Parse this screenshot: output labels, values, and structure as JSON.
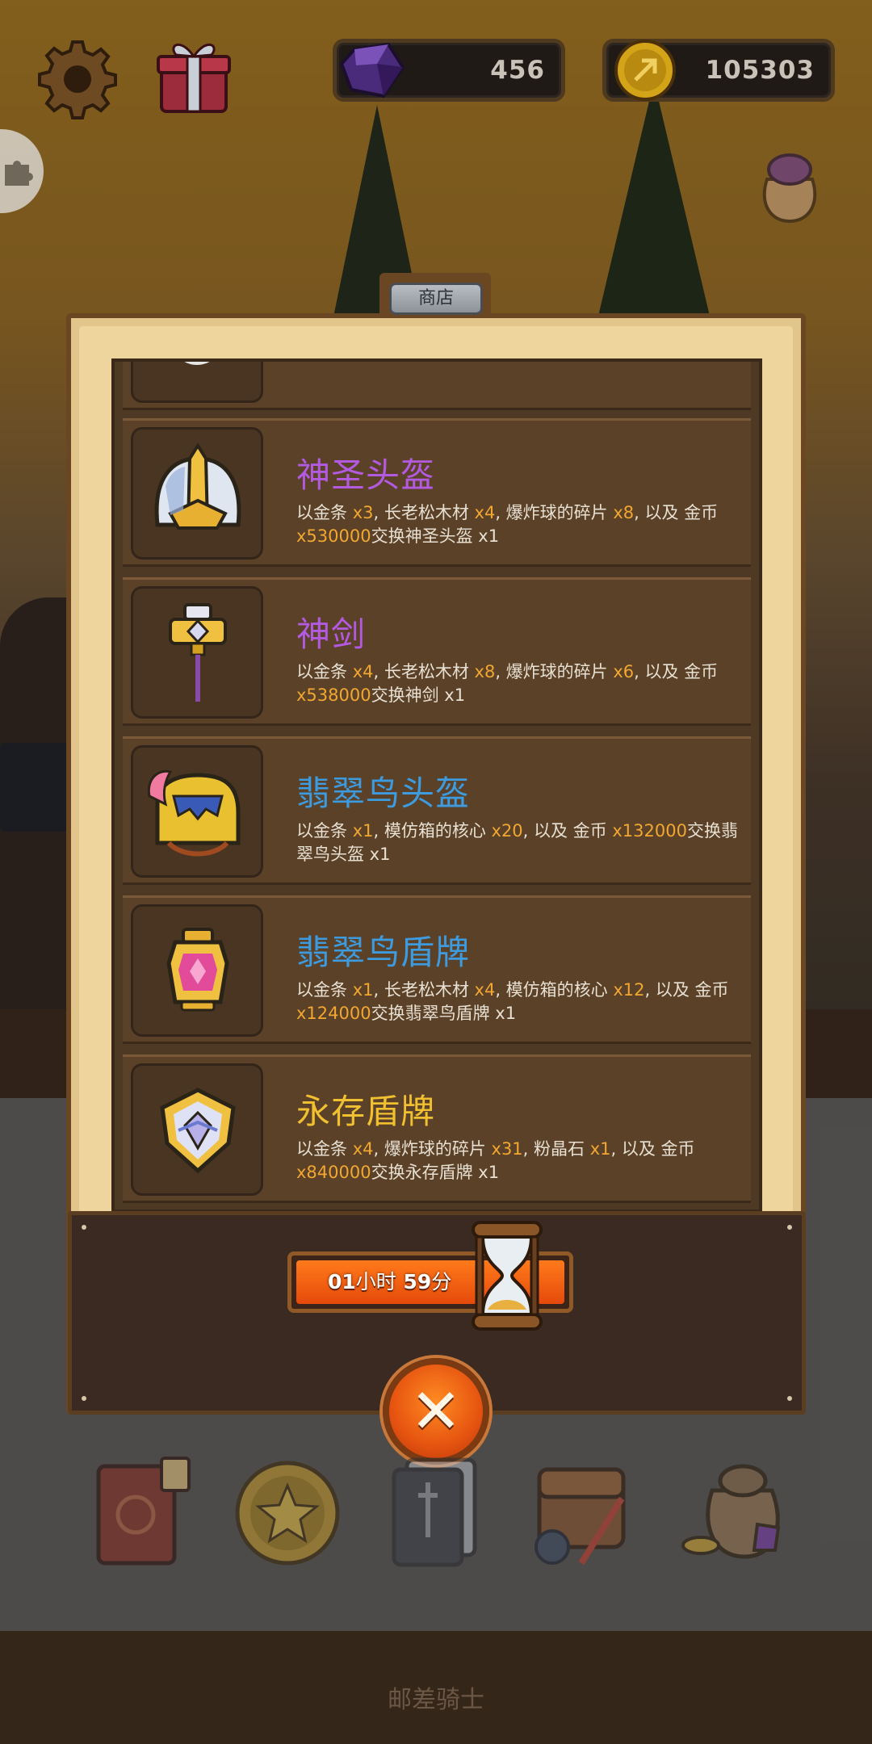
{
  "top_bar": {
    "gems_value": "456",
    "gold_value": "105303"
  },
  "shop": {
    "title": "商店",
    "items": [
      {
        "name": "神圣头盔",
        "name_color": "#b35ae0",
        "desc_parts": [
          "以金条 ",
          "x3",
          ", 长老松木材 ",
          "x4",
          ", 爆炸球的碎片 ",
          "x8",
          ", 以及 金币 ",
          "x530000",
          "交换神圣头盔 x1"
        ],
        "icon": "holy-helmet-icon"
      },
      {
        "name": "神剑",
        "name_color": "#b35ae0",
        "desc_parts": [
          "以金条 ",
          "x4",
          ", 长老松木材 ",
          "x8",
          ", 爆炸球的碎片 ",
          "x6",
          ", 以及 金币 ",
          "x538000",
          "交换神剑 x1"
        ],
        "icon": "holy-sword-icon"
      },
      {
        "name": "翡翠鸟头盔",
        "name_color": "#3d9be0",
        "desc_parts": [
          "以金条 ",
          "x1",
          ", 模仿箱的核心 ",
          "x20",
          ", 以及 金币 ",
          "x132000",
          "交换翡翠鸟头盔 x1",
          "",
          "",
          ""
        ],
        "icon": "kingfisher-helmet-icon"
      },
      {
        "name": "翡翠鸟盾牌",
        "name_color": "#3d9be0",
        "desc_parts": [
          "以金条 ",
          "x1",
          ", 长老松木材 ",
          "x4",
          ", 模仿箱的核心 ",
          "x12",
          ", 以及 金币 ",
          "x124000",
          "交换翡翠鸟盾牌 x1"
        ],
        "icon": "kingfisher-shield-icon"
      },
      {
        "name": "永存盾牌",
        "name_color": "#f0c030",
        "desc_parts": [
          "以金条 ",
          "x4",
          ", 爆炸球的碎片 ",
          "x31",
          ", 粉晶石 ",
          "x1",
          ", 以及 金币 ",
          "x840000",
          "交换永存盾牌 x1"
        ],
        "icon": "eternal-shield-icon"
      }
    ]
  },
  "timer": {
    "hours": "01",
    "hours_unit": "小时",
    "minutes": "59",
    "minutes_unit": "分"
  },
  "footer": {
    "text": "邮差骑士"
  }
}
